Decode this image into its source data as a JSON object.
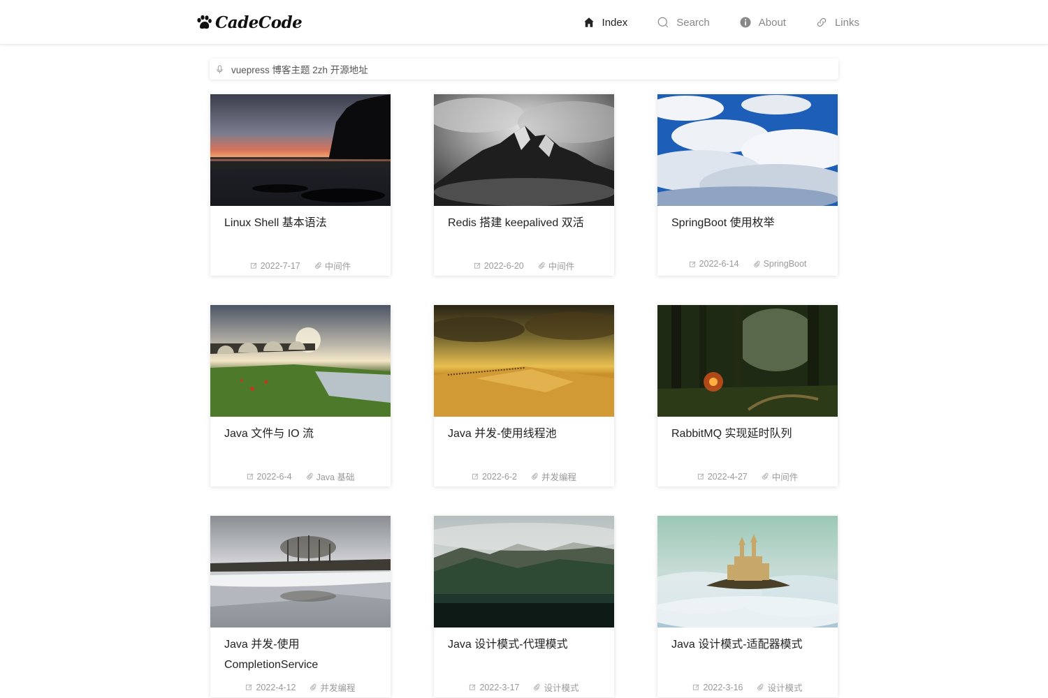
{
  "header": {
    "brand": "CadeCode",
    "nav": [
      {
        "label": "Index",
        "icon": "home-icon",
        "active": true
      },
      {
        "label": "Search",
        "icon": "search-icon",
        "active": false
      },
      {
        "label": "About",
        "icon": "info-icon",
        "active": false
      },
      {
        "label": "Links",
        "icon": "link-icon",
        "active": false
      }
    ]
  },
  "search": {
    "value": "vuepress 博客主题 2zh 开源地址",
    "icon": "microphone-icon"
  },
  "posts": [
    {
      "title": "Linux Shell 基本语法",
      "date": "2022-7-17",
      "tag": "中间件",
      "image": "lake-sunset"
    },
    {
      "title": "Redis 搭建 keepalived 双活",
      "date": "2022-6-20",
      "tag": "中间件",
      "image": "mountain-clouds-bw"
    },
    {
      "title": "SpringBoot 使用枚举",
      "date": "2022-6-14",
      "tag": "SpringBoot",
      "image": "blue-sky-clouds"
    },
    {
      "title": "Java 文件与 IO 流",
      "date": "2022-6-4",
      "tag": "Java 基础",
      "image": "stone-bridge-sunset"
    },
    {
      "title": "Java 并发-使用线程池",
      "date": "2022-6-2",
      "tag": "并发编程",
      "image": "golden-desert"
    },
    {
      "title": "RabbitMQ 实现延时队列",
      "date": "2022-4-27",
      "tag": "中间件",
      "image": "forest-light"
    },
    {
      "title": "Java 并发-使用 CompletionService",
      "date": "2022-4-12",
      "tag": "并发编程",
      "image": "winter-lake"
    },
    {
      "title": "Java 设计模式-代理模式",
      "date": "2022-3-17",
      "tag": "设计模式",
      "image": "misty-mountain-lake"
    },
    {
      "title": "Java 设计模式-适配器模式",
      "date": "2022-3-16",
      "tag": "设计模式",
      "image": "castle-in-clouds"
    }
  ],
  "colors": {
    "active_nav": "#222222",
    "inactive_nav": "#888888",
    "meta_text": "#9a9a9a"
  }
}
